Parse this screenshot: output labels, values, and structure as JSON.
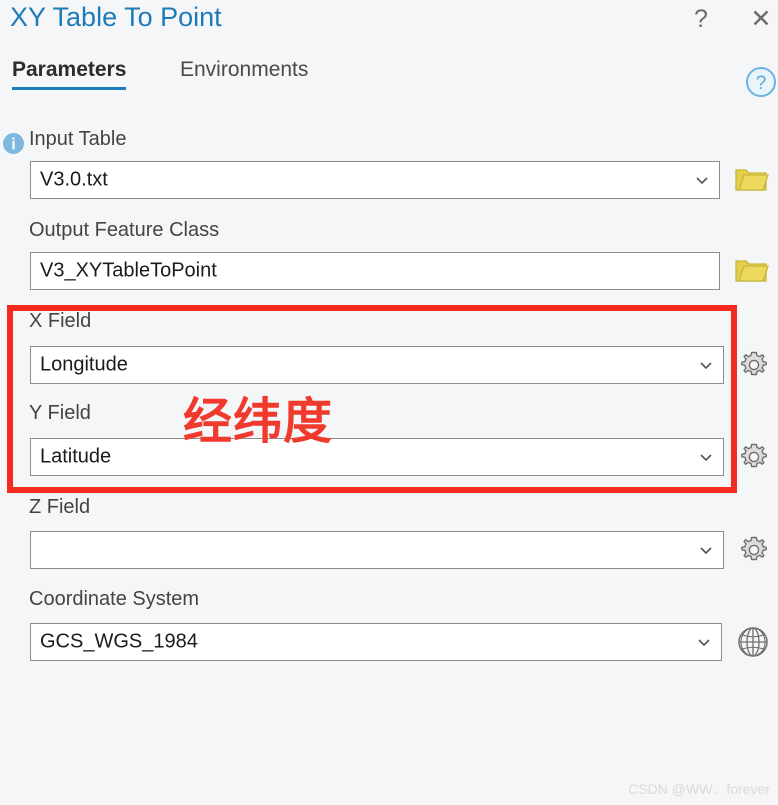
{
  "window": {
    "title": "XY Table To Point",
    "help_glyph": "?",
    "close_glyph": "✕",
    "title_color": "#1e7bb9"
  },
  "tabs": [
    {
      "label": "Parameters",
      "active": true
    },
    {
      "label": "Environments",
      "active": false
    }
  ],
  "panel_help": {
    "name": "help-circle-icon",
    "glyph": "?",
    "color": "#6cb3e0"
  },
  "fields": [
    {
      "label": "Input Table",
      "value": "V3.0.txt",
      "placeholder": "",
      "has_dropdown": true,
      "info_icon": "info-icon",
      "side_icon": "folder-icon"
    },
    {
      "label": "Output Feature Class",
      "value": "V3_XYTableToPoint",
      "placeholder": "",
      "has_dropdown": false,
      "info_icon": "",
      "side_icon": "folder-icon"
    },
    {
      "label": "X Field",
      "value": "Longitude",
      "placeholder": "",
      "has_dropdown": true,
      "info_icon": "",
      "side_icon": "gear-icon"
    },
    {
      "label": "Y Field",
      "value": "Latitude",
      "placeholder": "",
      "has_dropdown": true,
      "info_icon": "",
      "side_icon": "gear-icon"
    },
    {
      "label": "Z Field",
      "value": "",
      "placeholder": "",
      "has_dropdown": true,
      "info_icon": "",
      "side_icon": "gear-icon"
    },
    {
      "label": "Coordinate System",
      "value": "GCS_WGS_1984",
      "placeholder": "",
      "has_dropdown": true,
      "info_icon": "",
      "side_icon": "globe-icon"
    }
  ],
  "annotation": {
    "text": "经纬度",
    "color": "#f03a2e",
    "box_color": "#f72a20"
  },
  "watermark": {
    "text": "CSDN @WW、forever"
  },
  "colors": {
    "background": "#f5f6f7",
    "accent": "#1e7bb9",
    "folder": "#e0c93c",
    "gear": "#777777"
  }
}
